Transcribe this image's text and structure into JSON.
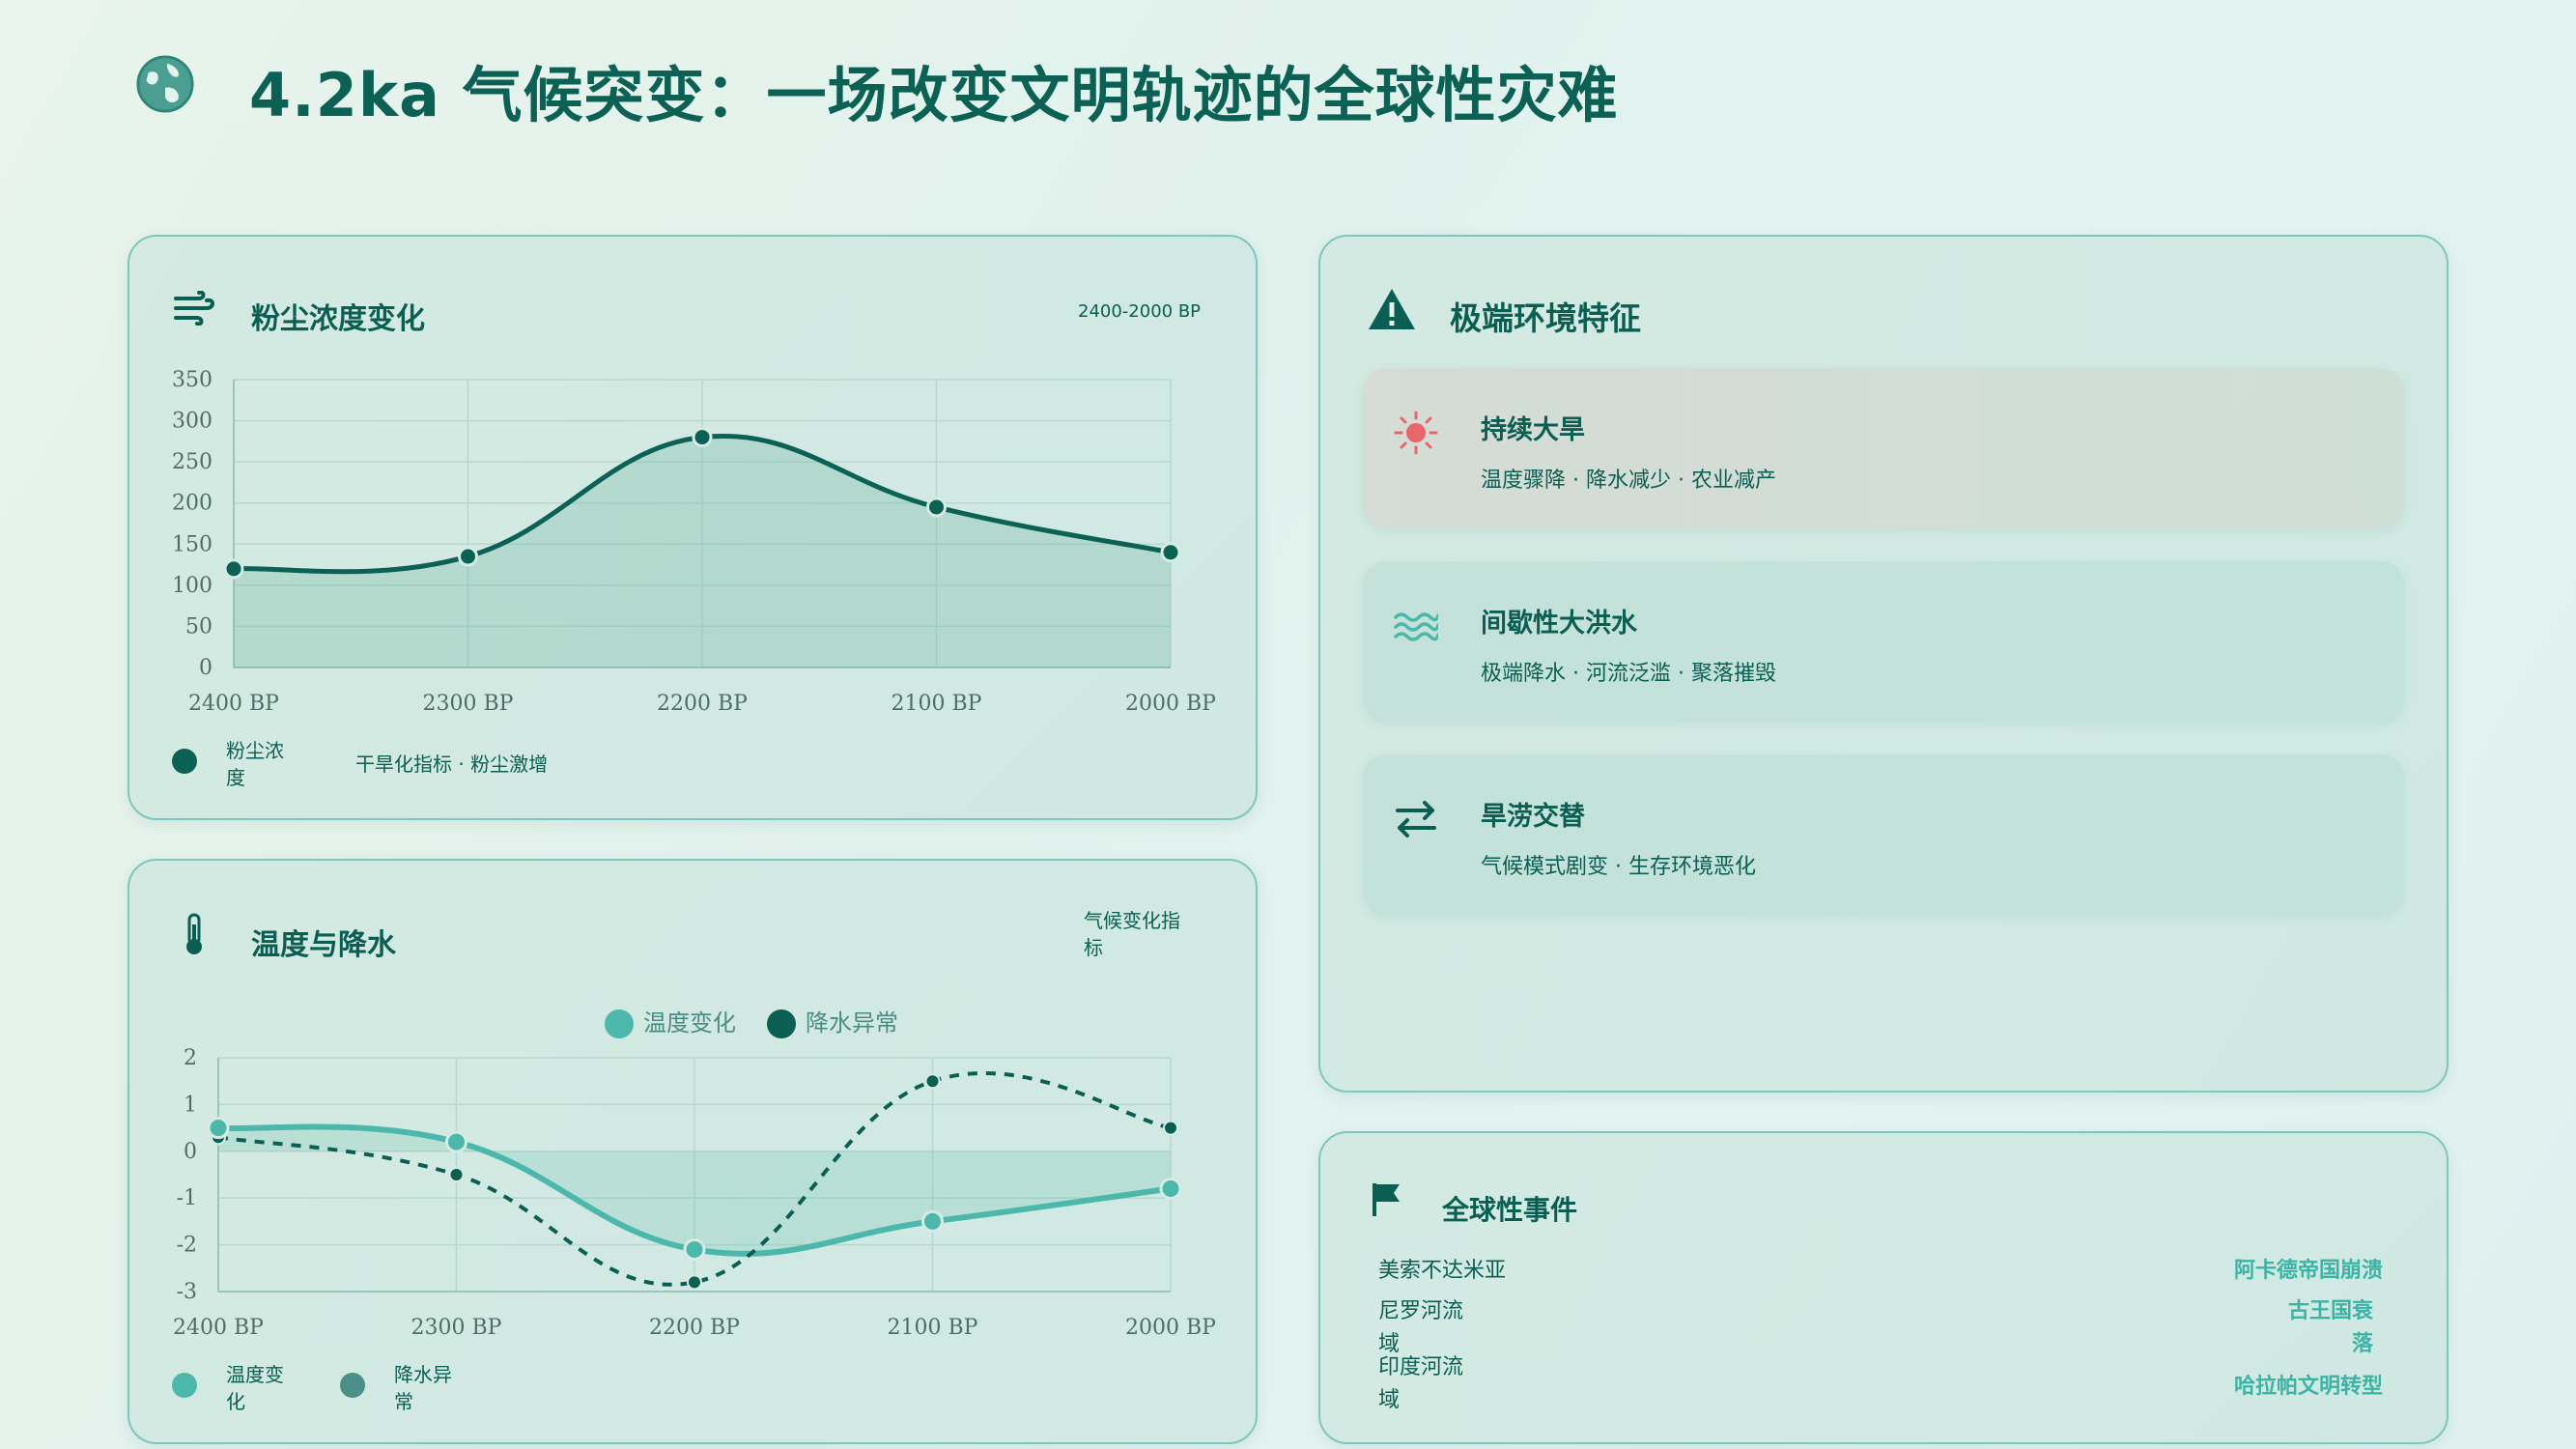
{
  "page": {
    "title": "4.2ka 气候突变：一场改变文明轨迹的全球性灾难"
  },
  "dust_card": {
    "title": "粉尘浓度变化",
    "range_label": "2400-2000 BP",
    "legend_label": "粉尘浓度",
    "legend_note": "干旱化指标 · 粉尘激增"
  },
  "climate_card": {
    "title": "温度与降水",
    "note": "气候变化指标",
    "legend_temp": "温度变化",
    "legend_precip": "降水异常"
  },
  "extreme_card": {
    "title": "极端环境特征",
    "features": [
      {
        "title": "持续大旱",
        "desc": "温度骤降 · 降水减少 · 农业减产"
      },
      {
        "title": "间歇性大洪水",
        "desc": "极端降水 · 河流泛滥 · 聚落摧毁"
      },
      {
        "title": "旱涝交替",
        "desc": "气候模式剧变 · 生存环境恶化"
      }
    ]
  },
  "events_card": {
    "title": "全球性事件",
    "regions": [
      "美索不达米亚",
      "尼罗河流域",
      "印度河流域"
    ],
    "events": [
      "阿卡德帝国崩溃",
      "古王国衰落",
      "哈拉帕文明转型"
    ]
  },
  "colors": {
    "primary": "#0b6153",
    "accent": "#4cb8ac",
    "warning": "#e8666a",
    "card_border": "#7fc6bc"
  },
  "icons": {
    "title": "globe-icon",
    "dust": "wind-icon",
    "climate": "thermometer-icon",
    "extreme": "warning-triangle-icon",
    "drought": "sun-icon",
    "flood": "water-waves-icon",
    "alternation": "exchange-arrows-icon",
    "events": "flag-icon"
  },
  "chart_data": [
    {
      "type": "area",
      "title": "粉尘浓度变化",
      "categories": [
        "2400 BP",
        "2300 BP",
        "2200 BP",
        "2100 BP",
        "2000 BP"
      ],
      "series": [
        {
          "name": "粉尘浓度",
          "values": [
            120,
            135,
            280,
            195,
            140
          ]
        }
      ],
      "ylim": [
        0,
        350
      ],
      "yticks": [
        0,
        50,
        100,
        150,
        200,
        250,
        300,
        350
      ],
      "grid": true,
      "legend": "bottom-left"
    },
    {
      "type": "line",
      "title": "温度与降水",
      "categories": [
        "2400 BP",
        "2300 BP",
        "2200 BP",
        "2100 BP",
        "2000 BP"
      ],
      "series": [
        {
          "name": "温度变化",
          "values": [
            0.5,
            0.2,
            -2.1,
            -1.5,
            -0.8
          ],
          "style": "solid-area"
        },
        {
          "name": "降水异常",
          "values": [
            0.3,
            -0.5,
            -2.8,
            1.5,
            0.5
          ],
          "style": "dashed"
        }
      ],
      "ylim": [
        -3,
        2
      ],
      "yticks": [
        -3,
        -2,
        -1,
        0,
        1,
        2
      ],
      "grid": true,
      "legend": "top-center"
    }
  ]
}
